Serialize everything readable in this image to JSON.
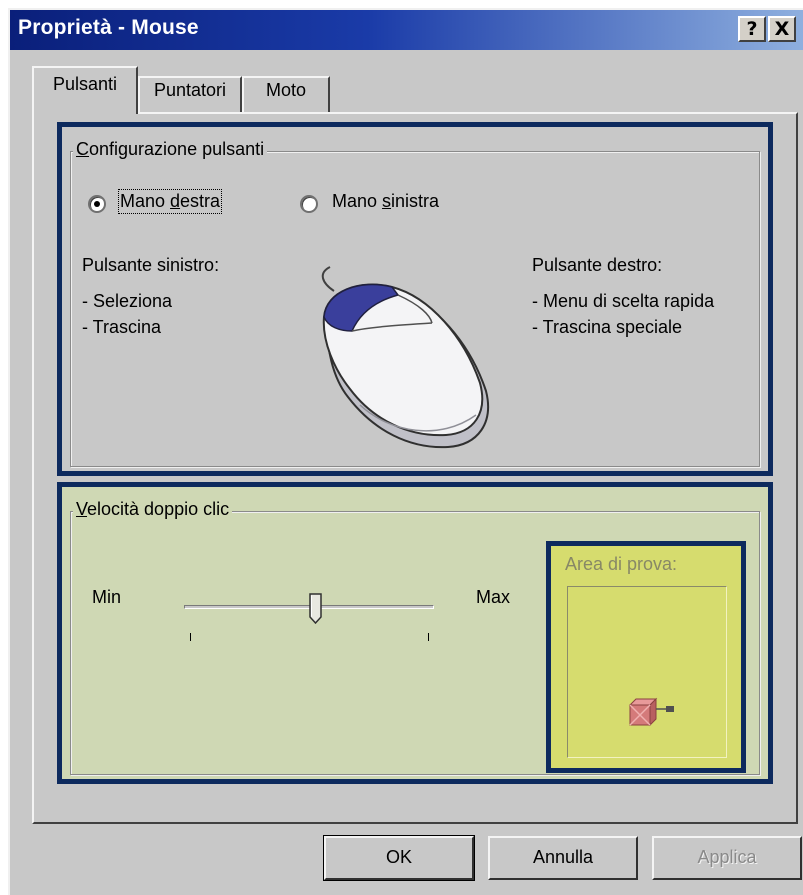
{
  "window": {
    "title": "Proprietà - Mouse",
    "help_button": "?",
    "close_button": "X"
  },
  "tabs": [
    {
      "label": "Pulsanti",
      "selected": true
    },
    {
      "label": "Puntatori",
      "selected": false
    },
    {
      "label": "Moto",
      "selected": false
    }
  ],
  "button_config": {
    "legend_first": "C",
    "legend_rest": "onfigurazione pulsanti",
    "radio_right": {
      "prefix": "Mano ",
      "mnemonic": "d",
      "rest": "estra",
      "selected": true
    },
    "radio_left": {
      "prefix": "Mano ",
      "mnemonic": "s",
      "rest": "inistra",
      "selected": false
    },
    "left_title": "Pulsante sinistro:",
    "left_actions": [
      "- Seleziona",
      "- Trascina"
    ],
    "right_title": "Pulsante destro:",
    "right_actions": [
      "- Menu di scelta rapida",
      "- Trascina speciale"
    ]
  },
  "double_click": {
    "legend_first": "V",
    "legend_rest": "elocità doppio clic",
    "min_label": "Min",
    "max_label": "Max",
    "slider_value": 0.53,
    "test_area_label": "Area di prova:",
    "highlight_color": "#cfd8b4",
    "test_area_color": "#d6dc6e"
  },
  "highlight_border_color": "#0d2a5e",
  "buttons": {
    "ok": "OK",
    "cancel": "Annulla",
    "apply": "Applica"
  }
}
